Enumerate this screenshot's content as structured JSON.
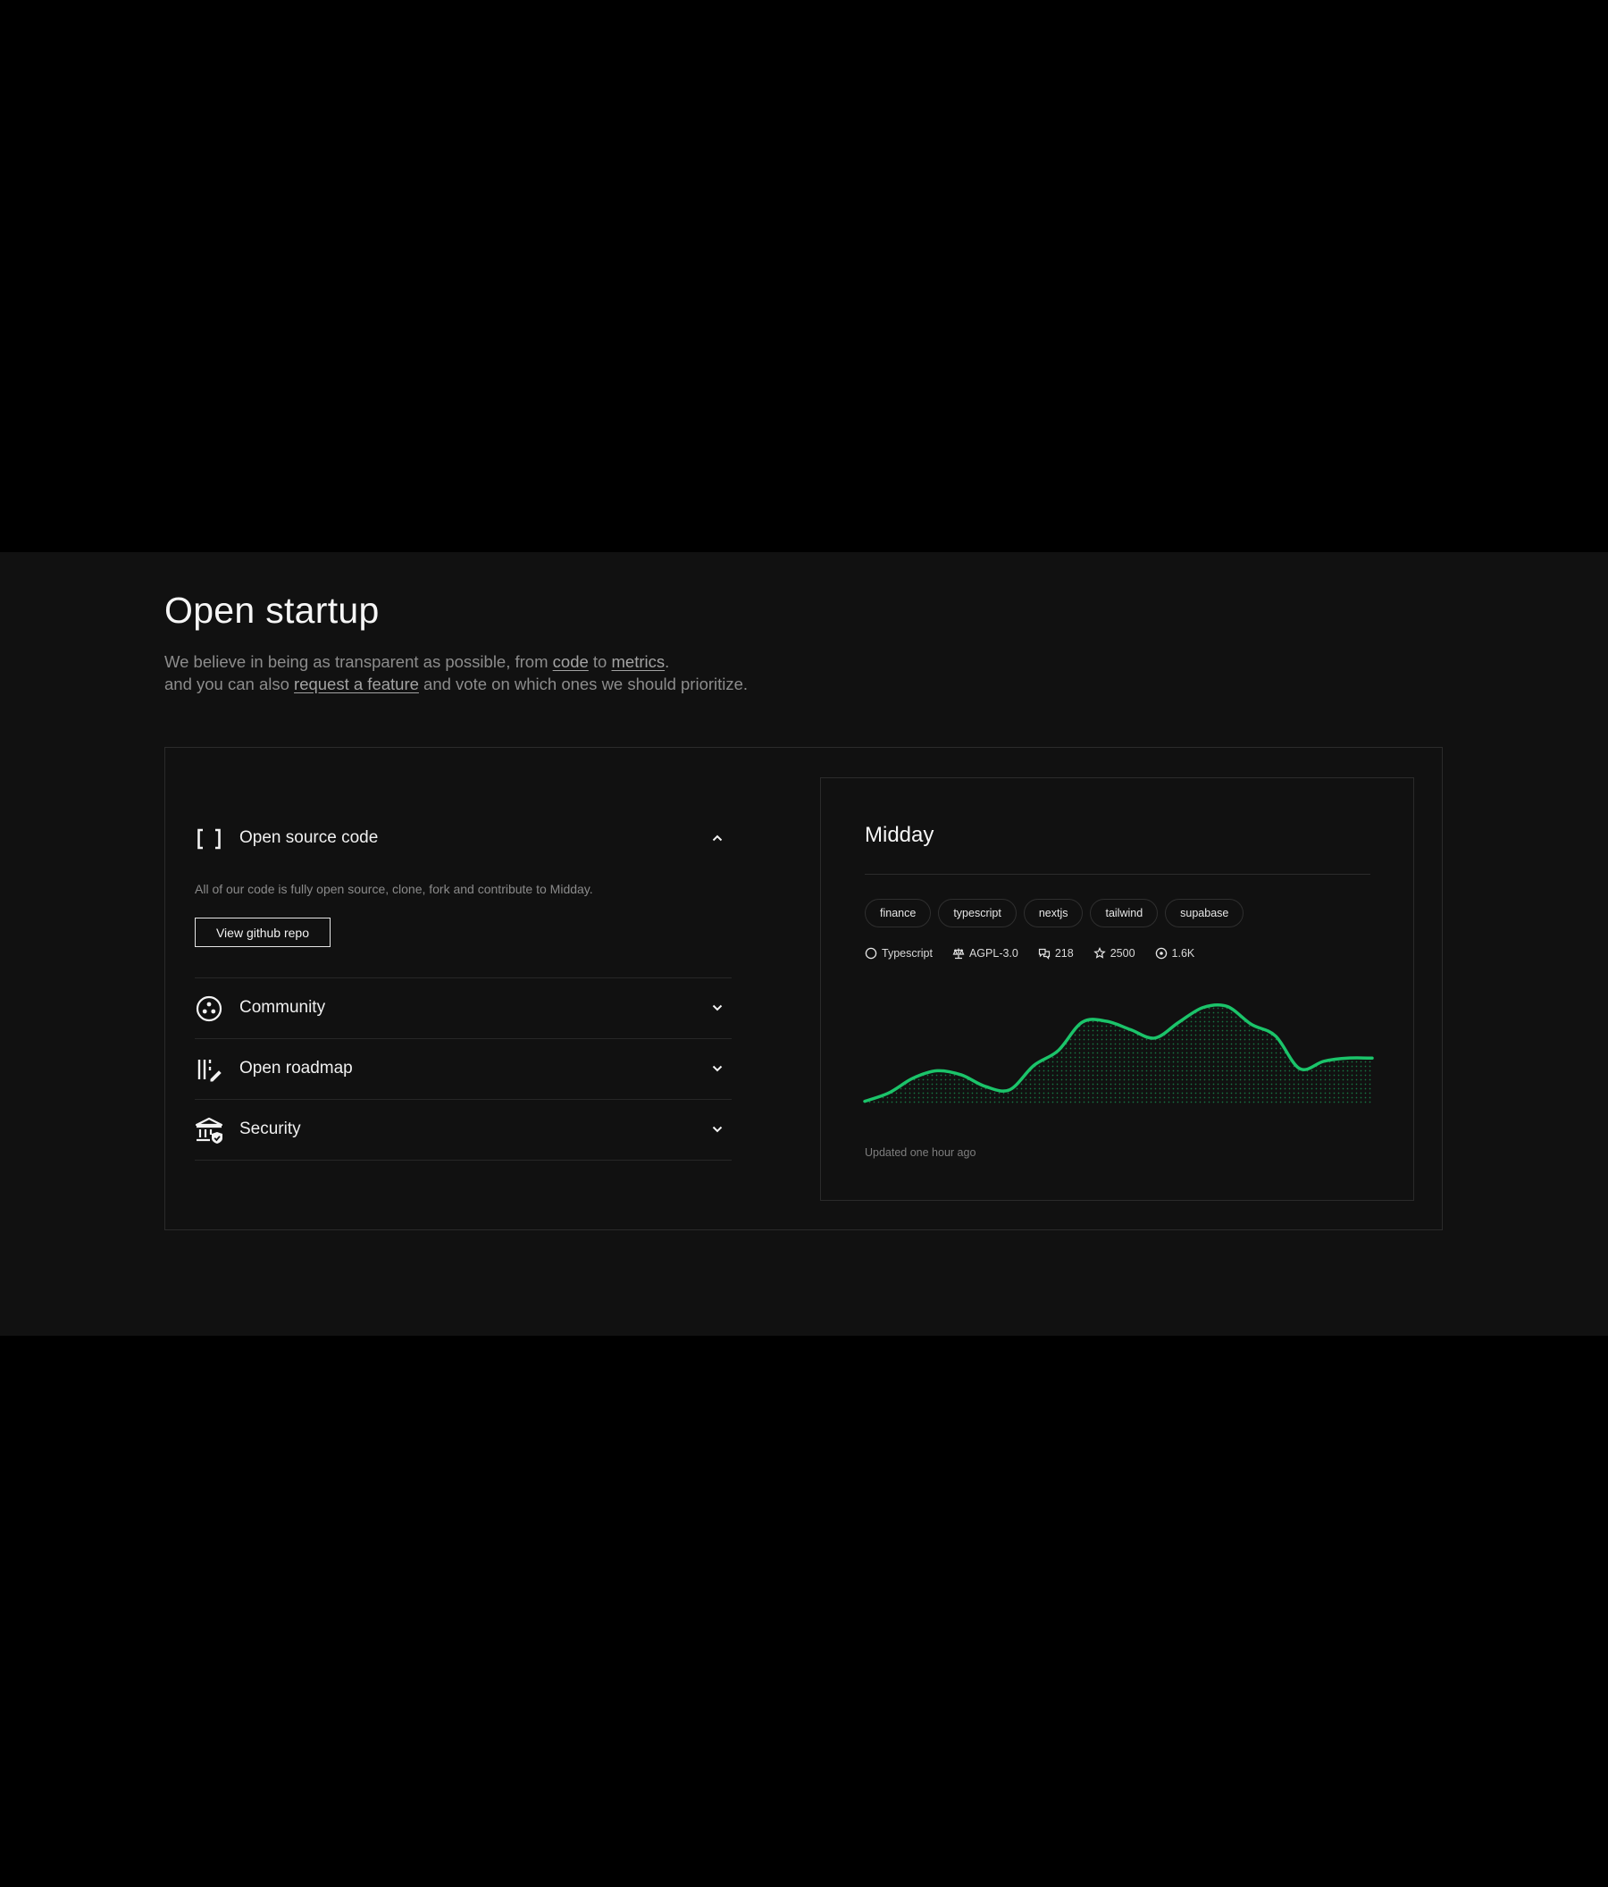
{
  "section": {
    "title": "Open startup",
    "intro": {
      "line1_prefix": "We believe in being as transparent as possible, from ",
      "link_code": "code",
      "line1_mid": " to ",
      "link_metrics": "metrics",
      "line1_suffix": ".",
      "line2_prefix": "and you can also ",
      "link_request": "request a feature",
      "line2_suffix": " and vote on which ones we should prioritize."
    }
  },
  "accordion": {
    "items": [
      {
        "label": "Open source code",
        "icon": "brackets-icon",
        "expanded": true,
        "description": "All of our code is fully open source, clone, fork and contribute to Midday.",
        "button_label": "View github repo"
      },
      {
        "label": "Community",
        "icon": "community-icon",
        "expanded": false
      },
      {
        "label": "Open roadmap",
        "icon": "roadmap-icon",
        "expanded": false
      },
      {
        "label": "Security",
        "icon": "bank-shield-icon",
        "expanded": false
      }
    ]
  },
  "repo": {
    "name": "Midday",
    "tags": [
      "finance",
      "typescript",
      "nextjs",
      "tailwind",
      "supabase"
    ],
    "stats": {
      "language": "Typescript",
      "license": "AGPL-3.0",
      "forks": "218",
      "stars": "2500",
      "watchers": "1.6K"
    },
    "updated": "Updated one hour ago"
  },
  "colors": {
    "accent": "#1bc46a",
    "background": "#111111",
    "page": "#000000",
    "border": "#2b2b2b"
  },
  "chart_data": {
    "type": "area",
    "title": "",
    "xlabel": "",
    "ylabel": "",
    "grid": false,
    "legend": "none",
    "ylim": [
      0,
      100
    ],
    "values": [
      2,
      10,
      24,
      31,
      27,
      16,
      13,
      36,
      50,
      77,
      78,
      70,
      62,
      77,
      91,
      92,
      75,
      64,
      33,
      40,
      43,
      43
    ]
  }
}
